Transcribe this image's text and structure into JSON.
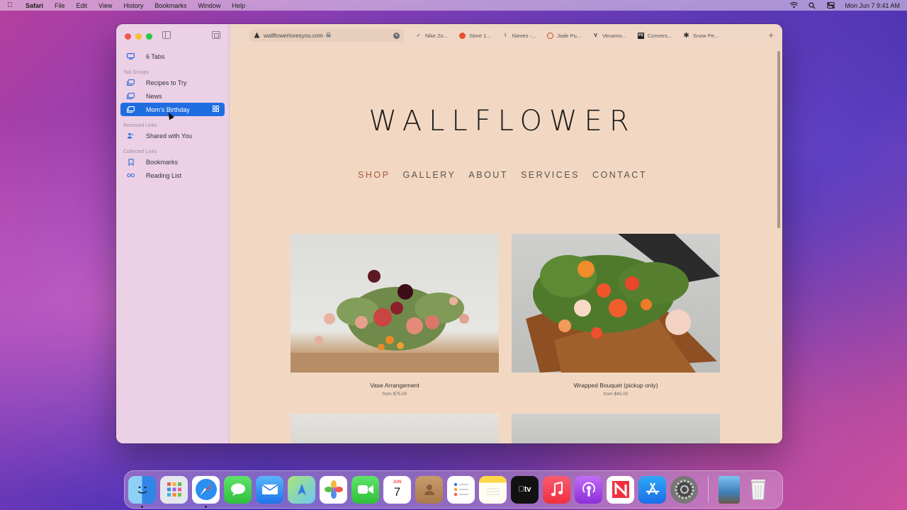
{
  "menubar": {
    "app_name": "Safari",
    "menus": [
      "File",
      "Edit",
      "View",
      "History",
      "Bookmarks",
      "Window",
      "Help"
    ],
    "clock": "Mon Jun 7  9:41 AM"
  },
  "sidebar": {
    "all_tabs": "6 Tabs",
    "tab_groups_header": "Tab Groups",
    "tab_groups": [
      "Recipes to Try",
      "News",
      "Mom's Birthday"
    ],
    "selected_group": "Mom's Birthday",
    "received_header": "Received Links",
    "shared_with_you": "Shared with You",
    "collected_header": "Collected Links",
    "bookmarks": "Bookmarks",
    "reading_list": "Reading List"
  },
  "tabbar": {
    "active_url": "wallflowerlovesyou.com",
    "tabs": [
      "Nike Zo...",
      "Store 1...",
      "Nieves -...",
      "Jade Pu...",
      "Venamo...",
      "Convers...",
      "Snow Pe..."
    ],
    "tab_icon_colors": [
      "#333333",
      "#e8502a",
      "#555555",
      "#c24a1f",
      "#222222",
      "#222222",
      "#333333"
    ]
  },
  "site": {
    "logo": "WALLFLOWER",
    "nav": [
      "SHOP",
      "GALLERY",
      "ABOUT",
      "SERVICES",
      "CONTACT"
    ],
    "active_nav": "SHOP",
    "products": [
      {
        "name": "Vase Arrangement",
        "price": "from $75.00"
      },
      {
        "name": "Wrapped Bouquet (pickup only)",
        "price": "from $45.00"
      }
    ]
  },
  "dock": {
    "apps": [
      "Finder",
      "Launchpad",
      "Safari",
      "Messages",
      "Mail",
      "Maps",
      "Photos",
      "FaceTime",
      "Calendar",
      "Contacts",
      "Reminders",
      "Notes",
      "TV",
      "Music",
      "Podcasts",
      "News",
      "App Store",
      "System Preferences",
      "Desktop Folder",
      "Trash"
    ],
    "calendar_month": "JUN",
    "calendar_day": "7"
  }
}
